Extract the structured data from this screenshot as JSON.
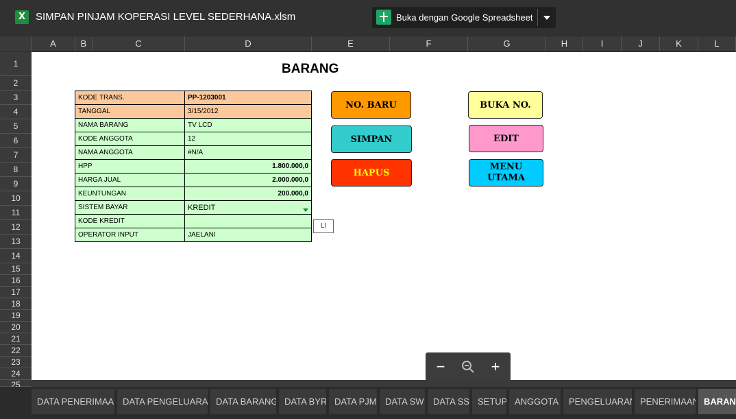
{
  "header": {
    "file_title": "SIMPAN PINJAM KOPERASI LEVEL SEDERHANA.xlsm",
    "app_icon": "excel-icon",
    "open_button_label": "Buka dengan Google Spreadsheet"
  },
  "columns": [
    "A",
    "B",
    "C",
    "D",
    "E",
    "F",
    "G",
    "H",
    "I",
    "J",
    "K",
    "L"
  ],
  "rows": [
    "1",
    "2",
    "3",
    "4",
    "5",
    "6",
    "7",
    "8",
    "9",
    "10",
    "11",
    "12",
    "13",
    "14",
    "15",
    "16",
    "17",
    "18",
    "19",
    "20",
    "21",
    "22",
    "23",
    "24",
    "25"
  ],
  "sheet": {
    "title": "BARANG",
    "form": [
      {
        "label": "KODE TRANS.",
        "value": "PP-1203001"
      },
      {
        "label": "TANGGAL",
        "value": "3/15/2012"
      },
      {
        "label": "NAMA BARANG",
        "value": "TV LCD"
      },
      {
        "label": "KODE ANGGOTA",
        "value": "12"
      },
      {
        "label": "NAMA ANGGOTA",
        "value": "#N/A"
      },
      {
        "label": "HPP",
        "value": "1.800.000,0"
      },
      {
        "label": "HARGA JUAL",
        "value": "2.000.000,0"
      },
      {
        "label": "KEUNTUNGAN",
        "value": "200.000,0"
      },
      {
        "label": "SISTEM BAYAR",
        "value": "KREDIT"
      },
      {
        "label": "KODE KREDIT",
        "value": ""
      },
      {
        "label": "OPERATOR INPUT",
        "value": "JAELANI"
      }
    ],
    "buttons": {
      "no_baru": "NO. BARU",
      "buka_no": "BUKA NO.",
      "simpan": "SIMPAN",
      "edit": "EDIT",
      "hapus": "HAPUS",
      "menu_utama": "MENU UTAMA"
    },
    "side_box": "LI"
  },
  "zoom": {
    "minus": "−",
    "plus": "+"
  },
  "tabs": [
    "DATA PENERIMAAN",
    "DATA PENGELUARAN",
    "DATA BARANG",
    "DATA BYR",
    "DATA PJM",
    "DATA SW",
    "DATA SS",
    "SETUP",
    "ANGGOTA",
    "PENGELUARAN",
    "PENERIMAAN",
    "BARANG"
  ],
  "colors": {
    "orange_fill": "#fac89b",
    "green_fill": "#ccffcc",
    "btn_no_baru": "#ff9900",
    "btn_simpan": "#33cccc",
    "btn_hapus": "#ff3300",
    "btn_buka_no": "#ffff99",
    "btn_edit": "#ff99cc",
    "btn_menu_utama": "#00ccff"
  }
}
